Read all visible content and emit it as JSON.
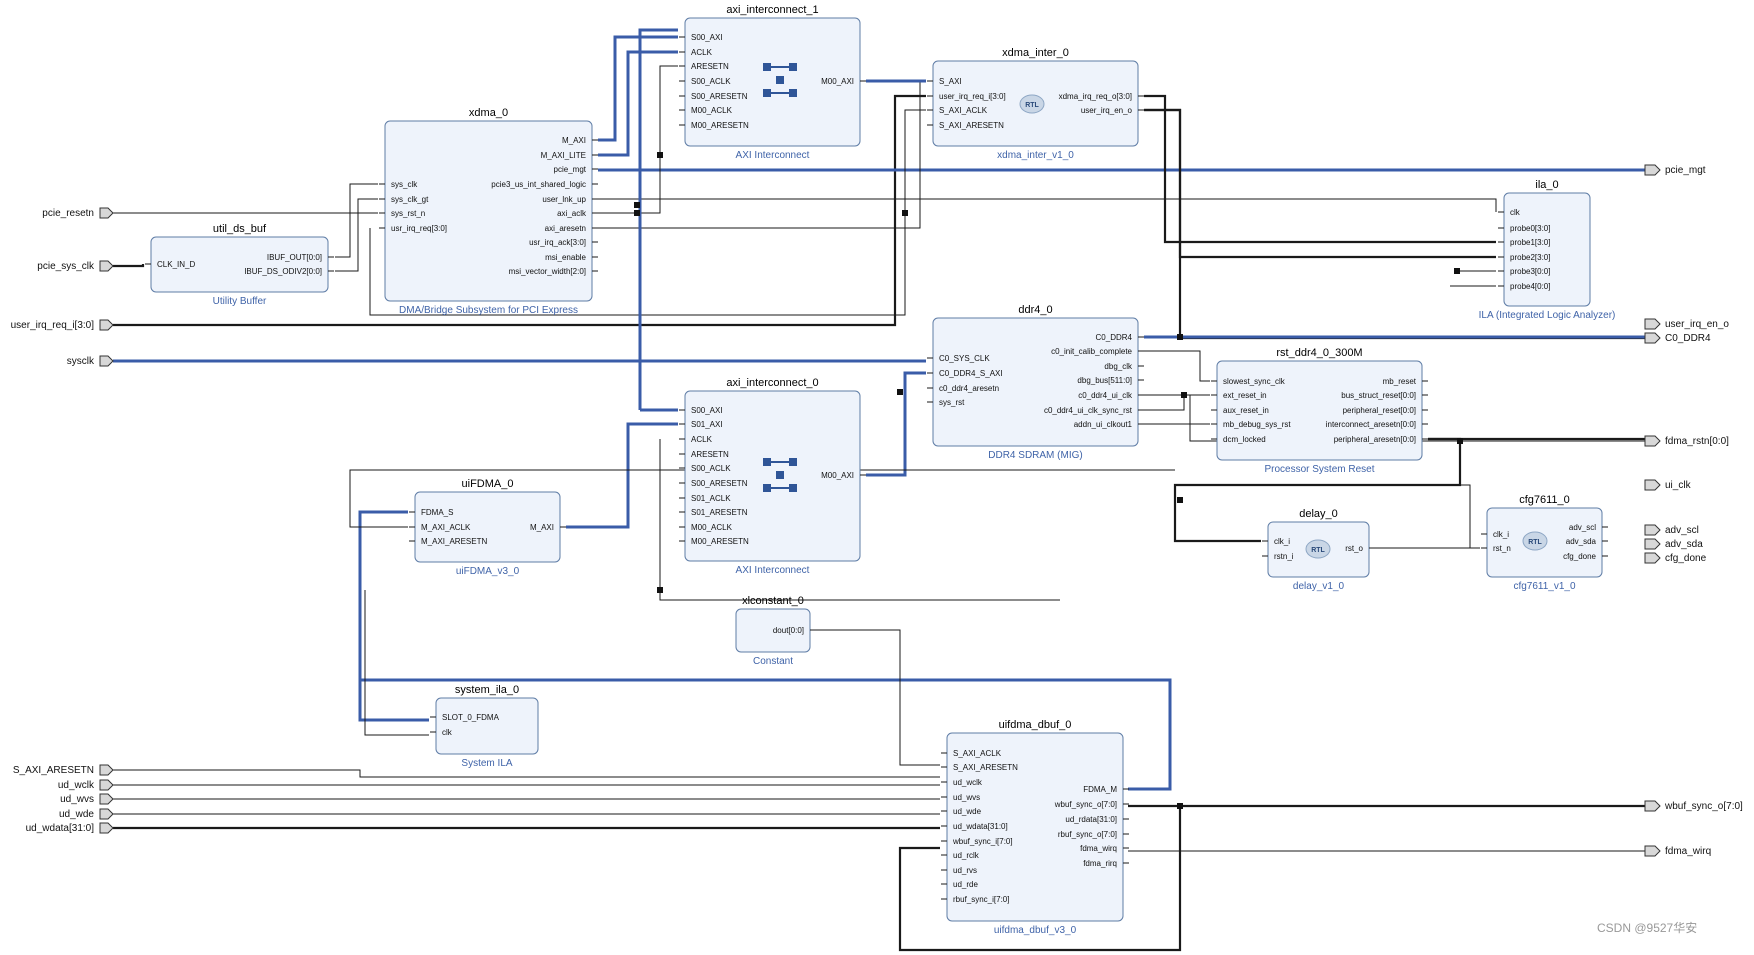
{
  "ext_inputs": [
    "pcie_resetn",
    "pcie_sys_clk",
    "user_irq_req_i[3:0]",
    "sysclk",
    "S_AXI_ARESETN",
    "ud_wclk",
    "ud_wvs",
    "ud_wde",
    "ud_wdata[31:0]"
  ],
  "ext_outputs": [
    "pcie_mgt",
    "user_irq_en_o",
    "C0_DDR4",
    "fdma_rstn[0:0]",
    "ui_clk",
    "adv_scl",
    "adv_sda",
    "cfg_done",
    "wbuf_sync_o[7:0]",
    "fdma_wirq"
  ],
  "blocks": {
    "axi_interconnect_1": {
      "name": "axi_interconnect_1",
      "subtitle": "AXI Interconnect",
      "left_pins": [
        "S00_AXI",
        "ACLK",
        "ARESETN",
        "S00_ACLK",
        "S00_ARESETN",
        "M00_ACLK",
        "M00_ARESETN"
      ],
      "right_pins": [
        "M00_AXI"
      ]
    },
    "xdma_inter_0": {
      "name": "xdma_inter_0",
      "subtitle": "xdma_inter_v1_0",
      "left_pins": [
        "S_AXI",
        "user_irq_req_i[3:0]",
        "S_AXI_ACLK",
        "S_AXI_ARESETN"
      ],
      "right_pins": [
        "xdma_irq_req_o[3:0]",
        "user_irq_en_o"
      ]
    },
    "xdma_0": {
      "name": "xdma_0",
      "subtitle": "DMA/Bridge Subsystem for PCI Express",
      "left_pins": [
        "sys_clk",
        "sys_clk_gt",
        "sys_rst_n",
        "usr_irq_req[3:0]"
      ],
      "right_pins": [
        "M_AXI",
        "M_AXI_LITE",
        "pcie_mgt",
        "pcie3_us_int_shared_logic",
        "user_lnk_up",
        "axi_aclk",
        "axi_aresetn",
        "usr_irq_ack[3:0]",
        "msi_enable",
        "msi_vector_width[2:0]"
      ]
    },
    "util_ds_buf": {
      "name": "util_ds_buf",
      "subtitle": "Utility Buffer",
      "left_pins": [
        "CLK_IN_D"
      ],
      "right_pins": [
        "IBUF_OUT[0:0]",
        "IBUF_DS_ODIV2[0:0]"
      ]
    },
    "ila_0": {
      "name": "ila_0",
      "subtitle": "ILA (Integrated Logic Analyzer)",
      "left_pins": [
        "clk",
        "probe0[3:0]",
        "probe1[3:0]",
        "probe2[3:0]",
        "probe3[0:0]",
        "probe4[0:0]"
      ],
      "right_pins": []
    },
    "ddr4_0": {
      "name": "ddr4_0",
      "subtitle": "DDR4 SDRAM (MIG)",
      "left_pins": [
        "C0_SYS_CLK",
        "C0_DDR4_S_AXI",
        "c0_ddr4_aresetn",
        "sys_rst"
      ],
      "right_pins": [
        "C0_DDR4",
        "c0_init_calib_complete",
        "dbg_clk",
        "dbg_bus[511:0]",
        "c0_ddr4_ui_clk",
        "c0_ddr4_ui_clk_sync_rst",
        "addn_ui_clkout1"
      ]
    },
    "rst_ddr4_0_300M": {
      "name": "rst_ddr4_0_300M",
      "subtitle": "Processor System Reset",
      "left_pins": [
        "slowest_sync_clk",
        "ext_reset_in",
        "aux_reset_in",
        "mb_debug_sys_rst",
        "dcm_locked"
      ],
      "right_pins": [
        "mb_reset",
        "bus_struct_reset[0:0]",
        "peripheral_reset[0:0]",
        "interconnect_aresetn[0:0]",
        "peripheral_aresetn[0:0]"
      ]
    },
    "axi_interconnect_0": {
      "name": "axi_interconnect_0",
      "subtitle": "AXI Interconnect",
      "left_pins": [
        "S00_AXI",
        "S01_AXI",
        "ACLK",
        "ARESETN",
        "S00_ACLK",
        "S00_ARESETN",
        "S01_ACLK",
        "S01_ARESETN",
        "M00_ACLK",
        "M00_ARESETN"
      ],
      "right_pins": [
        "M00_AXI"
      ]
    },
    "uiFDMA_0": {
      "name": "uiFDMA_0",
      "subtitle": "uiFDMA_v3_0",
      "left_pins": [
        "FDMA_S",
        "M_AXI_ACLK",
        "M_AXI_ARESETN"
      ],
      "right_pins": [
        "M_AXI"
      ]
    },
    "delay_0": {
      "name": "delay_0",
      "subtitle": "delay_v1_0",
      "left_pins": [
        "clk_i",
        "rstn_i"
      ],
      "right_pins": [
        "rst_o"
      ]
    },
    "cfg7611_0": {
      "name": "cfg7611_0",
      "subtitle": "cfg7611_v1_0",
      "left_pins": [
        "clk_i",
        "rst_n"
      ],
      "right_pins": [
        "adv_scl",
        "adv_sda",
        "cfg_done"
      ]
    },
    "xlconstant_0": {
      "name": "xlconstant_0",
      "subtitle": "Constant",
      "left_pins": [],
      "right_pins": [
        "dout[0:0]"
      ]
    },
    "system_ila_0": {
      "name": "system_ila_0",
      "subtitle": "System ILA",
      "left_pins": [
        "SLOT_0_FDMA",
        "clk"
      ],
      "right_pins": []
    },
    "uifdma_dbuf_0": {
      "name": "uifdma_dbuf_0",
      "subtitle": "uifdma_dbuf_v3_0",
      "left_pins": [
        "S_AXI_ACLK",
        "S_AXI_ARESETN",
        "ud_wclk",
        "ud_wvs",
        "ud_wde",
        "ud_wdata[31:0]",
        "wbuf_sync_i[7:0]",
        "ud_rclk",
        "ud_rvs",
        "ud_rde",
        "rbuf_sync_i[7:0]"
      ],
      "right_pins": [
        "FDMA_M",
        "wbuf_sync_o[7:0]",
        "ud_rdata[31:0]",
        "rbuf_sync_o[7:0]",
        "fdma_wirq",
        "fdma_rirq"
      ]
    }
  },
  "rtl_label": "RTL",
  "watermark": "CSDN @9527华安",
  "colors": {
    "block_fill": "#eef3fb",
    "block_stroke": "#5f7da6",
    "bus": "#3a5ca8",
    "subtitle": "#3f63a8"
  }
}
